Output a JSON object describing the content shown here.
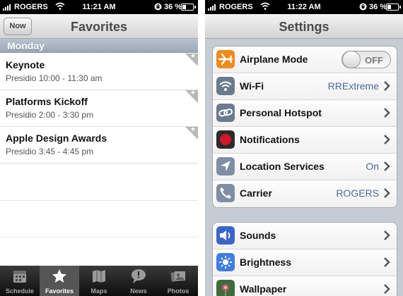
{
  "left": {
    "status": {
      "carrier": "ROGERS",
      "time": "11:21 AM",
      "battery": "36 %",
      "battery_level": 0.36
    },
    "nav": {
      "title": "Favorites",
      "button": "Now"
    },
    "section": "Monday",
    "sessions": [
      {
        "title": "Keynote",
        "detail": "Presidio 10:00 - 11:30 am"
      },
      {
        "title": "Platforms Kickoff",
        "detail": "Presidio 2:00 - 3:30 pm"
      },
      {
        "title": "Apple Design Awards",
        "detail": "Presidio 3:45 - 4:45 pm"
      }
    ],
    "tabs": [
      {
        "label": "Schedule",
        "icon": "calendar-icon"
      },
      {
        "label": "Favorites",
        "icon": "star-icon",
        "active": true
      },
      {
        "label": "Maps",
        "icon": "map-icon"
      },
      {
        "label": "News",
        "icon": "speech-bubble-icon"
      },
      {
        "label": "Photos",
        "icon": "photos-icon"
      }
    ]
  },
  "right": {
    "status": {
      "carrier": "ROGERS",
      "time": "11:22 AM",
      "battery": "36 %",
      "battery_level": 0.36
    },
    "nav": {
      "title": "Settings"
    },
    "groups": [
      [
        {
          "label": "Airplane Mode",
          "icon": "airplane-icon",
          "toggle": "OFF",
          "color": "#f08a1c"
        },
        {
          "label": "Wi-Fi",
          "icon": "wifi-icon",
          "value": "RRExtreme",
          "color": "#6b7a8d"
        },
        {
          "label": "Personal Hotspot",
          "icon": "link-icon",
          "color": "#6b7a8d"
        },
        {
          "label": "Notifications",
          "icon": "notifications-icon",
          "color": "#d3182a"
        },
        {
          "label": "Location Services",
          "icon": "location-icon",
          "value": "On",
          "color": "#7f8ea2"
        },
        {
          "label": "Carrier",
          "icon": "phone-icon",
          "value": "ROGERS",
          "color": "#7f8ea2"
        }
      ],
      [
        {
          "label": "Sounds",
          "icon": "speaker-icon",
          "color": "#3b66c7"
        },
        {
          "label": "Brightness",
          "icon": "brightness-icon",
          "color": "#3f7ee0"
        },
        {
          "label": "Wallpaper",
          "icon": "wallpaper-icon",
          "color": "#c1558a"
        }
      ]
    ]
  }
}
